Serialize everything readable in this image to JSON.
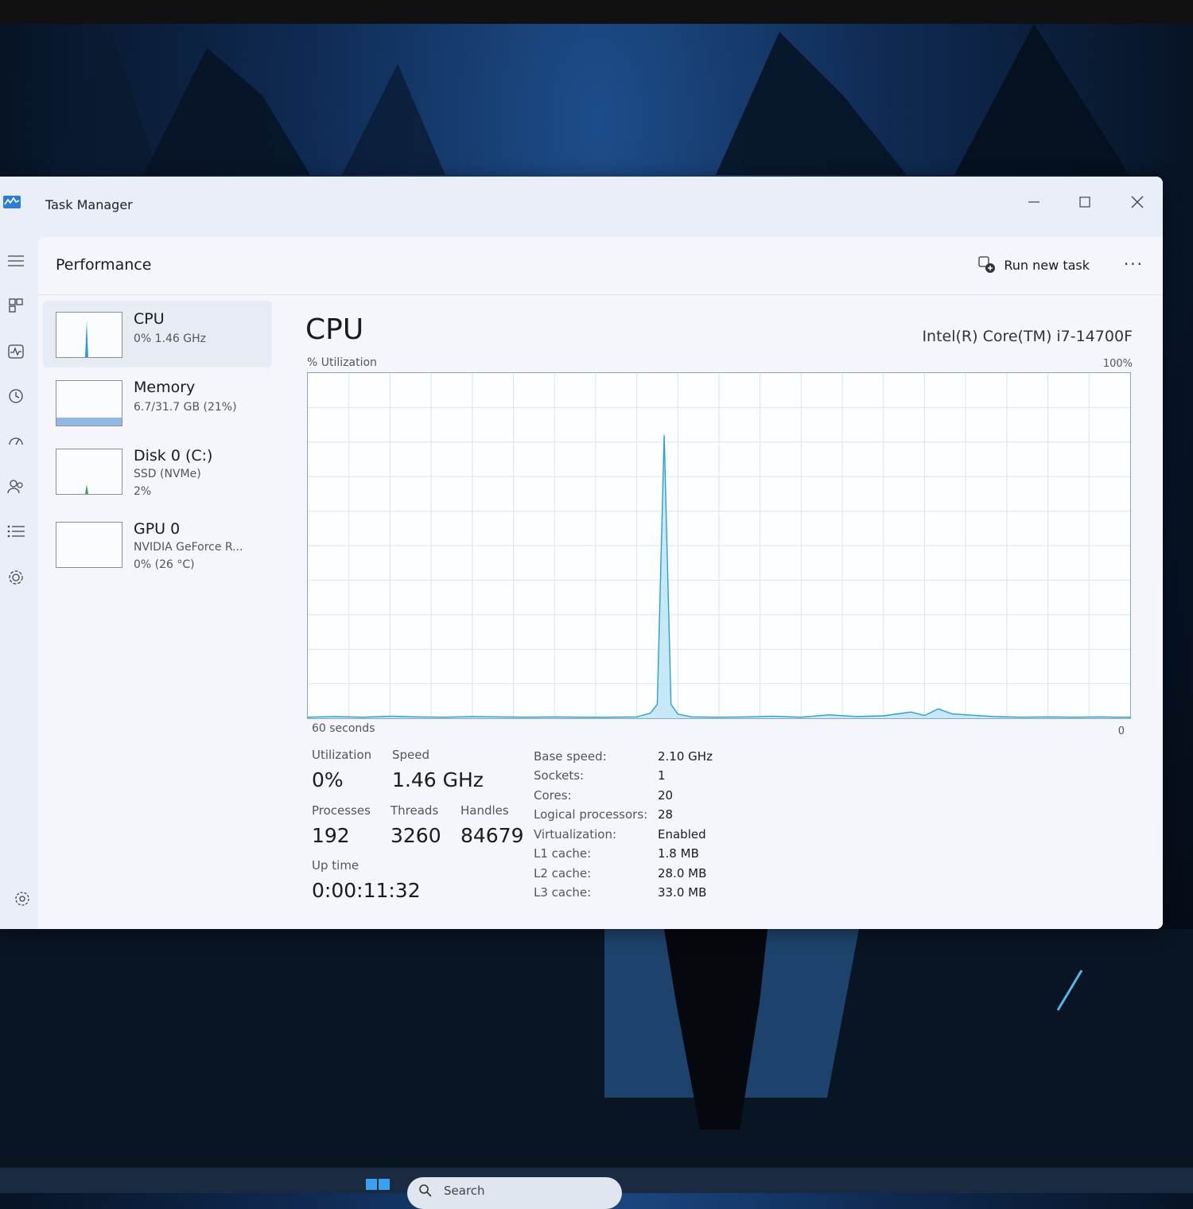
{
  "window": {
    "title": "Task Manager"
  },
  "header": {
    "page_title": "Performance",
    "run_new_task": "Run new task",
    "more": "···"
  },
  "nav_icons": [
    "hamburger-menu-icon",
    "processes-icon",
    "performance-icon",
    "app-history-icon",
    "startup-apps-icon",
    "users-icon",
    "details-icon",
    "services-icon",
    "settings-icon"
  ],
  "side_items": [
    {
      "name": "CPU",
      "sub1": "0% 1.46 GHz",
      "sub2": ""
    },
    {
      "name": "Memory",
      "sub1": "6.7/31.7 GB (21%)",
      "sub2": ""
    },
    {
      "name": "Disk 0 (C:)",
      "sub1": "SSD (NVMe)",
      "sub2": "2%"
    },
    {
      "name": "GPU 0",
      "sub1": "NVIDIA GeForce R...",
      "sub2": "0% (26 °C)"
    }
  ],
  "main": {
    "title": "CPU",
    "model": "Intel(R) Core(TM) i7-14700F",
    "util_label": "% Utilization",
    "max_label": "100%",
    "time_label": "60 seconds",
    "zero_label": "0"
  },
  "stats": {
    "utilization_label": "Utilization",
    "utilization": "0%",
    "speed_label": "Speed",
    "speed": "1.46 GHz",
    "processes_label": "Processes",
    "processes": "192",
    "threads_label": "Threads",
    "threads": "3260",
    "handles_label": "Handles",
    "handles": "84679",
    "uptime_label": "Up time",
    "uptime": "0:00:11:32"
  },
  "specs": [
    {
      "key": "Base speed:",
      "value": "2.10 GHz"
    },
    {
      "key": "Sockets:",
      "value": "1"
    },
    {
      "key": "Cores:",
      "value": "20"
    },
    {
      "key": "Logical processors:",
      "value": "28"
    },
    {
      "key": "Virtualization:",
      "value": "Enabled"
    },
    {
      "key": "L1 cache:",
      "value": "1.8 MB"
    },
    {
      "key": "L2 cache:",
      "value": "28.0 MB"
    },
    {
      "key": "L3 cache:",
      "value": "33.0 MB"
    }
  ],
  "taskbar": {
    "search_placeholder": "Search"
  },
  "colors": {
    "accent": "#1a8fc9",
    "graph_fill": "#bde4f5",
    "graph_line": "#2b9fd1",
    "memory_fill": "#8fb9e8",
    "disk_line": "#3aa15a"
  },
  "chart_data": {
    "type": "area",
    "x_range": [
      60,
      0
    ],
    "ylim": [
      0,
      100
    ],
    "x": [
      60,
      58,
      56,
      54,
      52,
      50,
      48,
      46,
      44,
      42,
      40,
      38,
      36,
      35,
      34.5,
      34,
      33.5,
      33,
      32,
      30,
      28,
      26,
      24,
      22,
      20,
      18,
      16,
      15,
      14,
      13,
      12,
      10,
      8,
      6,
      4,
      2,
      1,
      0
    ],
    "values": [
      0.3,
      0.5,
      0.3,
      0.6,
      0.4,
      0.3,
      0.5,
      0.4,
      0.3,
      0.4,
      0.3,
      0.3,
      0.4,
      1.5,
      4,
      82,
      4,
      1.2,
      0.4,
      0.3,
      0.4,
      0.6,
      0.3,
      1.0,
      0.5,
      0.7,
      1.8,
      0.8,
      2.7,
      1.3,
      1.0,
      0.5,
      0.3,
      0.4,
      0.3,
      0.4,
      0.3,
      0.3
    ]
  }
}
